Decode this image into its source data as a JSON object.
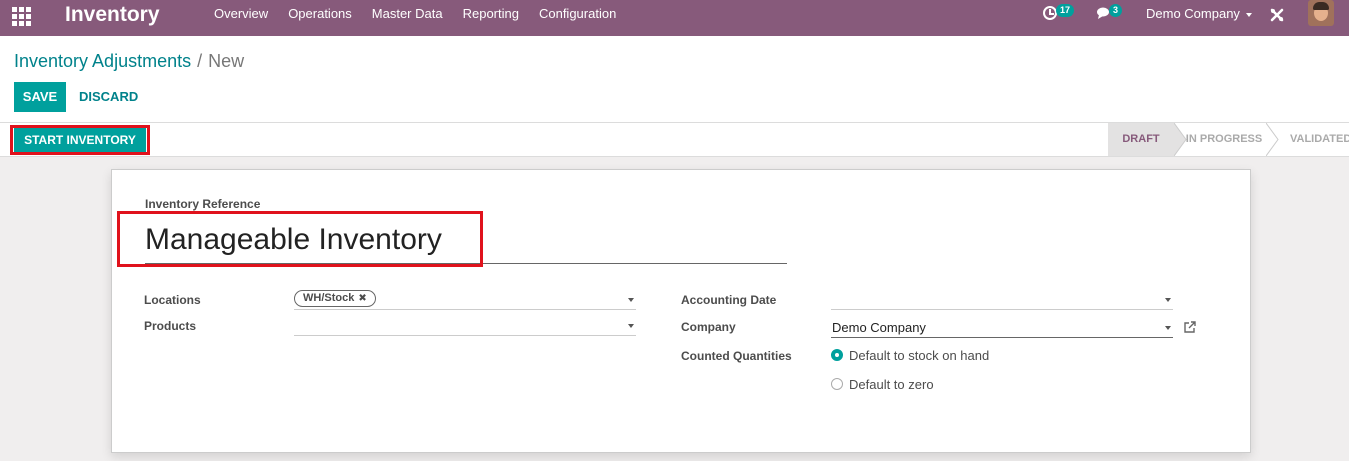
{
  "navbar": {
    "app_title": "Inventory",
    "menu": [
      "Overview",
      "Operations",
      "Master Data",
      "Reporting",
      "Configuration"
    ],
    "activity_count": "17",
    "message_count": "3",
    "company": "Demo Company"
  },
  "breadcrumb": {
    "parent": "Inventory Adjustments",
    "separator": "/",
    "current": "New"
  },
  "toolbar": {
    "save_label": "SAVE",
    "discard_label": "DISCARD"
  },
  "status": {
    "start_label": "START INVENTORY",
    "stages": [
      "DRAFT",
      "IN PROGRESS",
      "VALIDATED"
    ],
    "active_stage": "DRAFT"
  },
  "form": {
    "reference_label": "Inventory Reference",
    "reference_value": "Manageable Inventory",
    "locations_label": "Locations",
    "locations_tag": "WH/Stock",
    "products_label": "Products",
    "products_value": "",
    "accounting_date_label": "Accounting Date",
    "accounting_date_value": "",
    "company_label": "Company",
    "company_value": "Demo Company",
    "counted_label": "Counted Quantities",
    "counted_options": [
      "Default to stock on hand",
      "Default to zero"
    ],
    "counted_selected": "Default to stock on hand"
  },
  "colors": {
    "navbar": "#875a7b",
    "primary": "#00a09d",
    "link": "#00828b",
    "highlight": "#e0121c"
  }
}
